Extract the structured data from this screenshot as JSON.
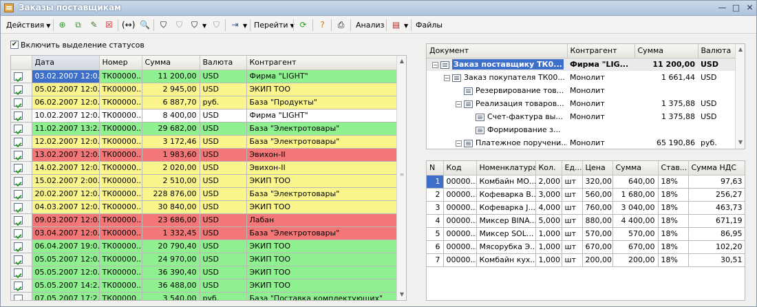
{
  "window": {
    "title": "Заказы поставщикам",
    "min": "—",
    "max": "□",
    "close": "✕"
  },
  "toolbar": {
    "actions": "Действия",
    "goto": "Перейти",
    "analysis": "Анализ",
    "files": "Файлы"
  },
  "status_checkbox": {
    "label": "Включить выделение статусов",
    "checked": "✔"
  },
  "orders": {
    "columns": [
      "",
      "Дата",
      "Номер",
      "Сумма",
      "Валюта",
      "Контрагент"
    ],
    "rows": [
      {
        "date": "03.02.2007 12:0...",
        "num": "ТК00000...",
        "sum": "11 200,00",
        "cur": "USD",
        "party": "Фирма \"LIGHT\"",
        "c": "g"
      },
      {
        "date": "05.02.2007 12:0...",
        "num": "ТК00000...",
        "sum": "2 945,00",
        "cur": "USD",
        "party": "ЭКИП ТОО",
        "c": "y"
      },
      {
        "date": "06.02.2007 12:0...",
        "num": "ТК00000...",
        "sum": "6 887,70",
        "cur": "руб.",
        "party": "База \"Продукты\"",
        "c": "y"
      },
      {
        "date": "10.02.2007 12:0...",
        "num": "ТК00000...",
        "sum": "8 400,00",
        "cur": "USD",
        "party": "Фирма \"LIGHT\"",
        "c": "w"
      },
      {
        "date": "11.02.2007 13:2...",
        "num": "ТК00000...",
        "sum": "29 682,00",
        "cur": "USD",
        "party": "База \"Электротовары\"",
        "c": "g"
      },
      {
        "date": "12.02.2007 12:0...",
        "num": "ТК00000...",
        "sum": "3 172,46",
        "cur": "USD",
        "party": "База \"Электротовары\"",
        "c": "y"
      },
      {
        "date": "13.02.2007 12:0...",
        "num": "ТК00000...",
        "sum": "1 983,60",
        "cur": "USD",
        "party": "Эвихон-II",
        "c": "r"
      },
      {
        "date": "14.02.2007 12:0...",
        "num": "ТК00000...",
        "sum": "2 020,00",
        "cur": "USD",
        "party": "Эвихон-II",
        "c": "y"
      },
      {
        "date": "15.02.2007 2:00...",
        "num": "ТК00000...",
        "sum": "2 510,00",
        "cur": "USD",
        "party": "ЭКИП ТОО",
        "c": "y"
      },
      {
        "date": "20.02.2007 12:0...",
        "num": "ТК00000...",
        "sum": "228 876,00",
        "cur": "USD",
        "party": "База \"Электротовары\"",
        "c": "y"
      },
      {
        "date": "04.03.2007 12:0...",
        "num": "ТК00000...",
        "sum": "30 840,00",
        "cur": "USD",
        "party": "ЭКИП ТОО",
        "c": "y"
      },
      {
        "date": "09.03.2007 12:0...",
        "num": "ТК00000...",
        "sum": "23 686,00",
        "cur": "USD",
        "party": "Лабан",
        "c": "r"
      },
      {
        "date": "03.04.2007 12:0...",
        "num": "ТК00000...",
        "sum": "1 332,45",
        "cur": "USD",
        "party": "База \"Электротовары\"",
        "c": "r"
      },
      {
        "date": "06.04.2007 19:0...",
        "num": "ТК00000...",
        "sum": "20 790,40",
        "cur": "USD",
        "party": "ЭКИП ТОО",
        "c": "g"
      },
      {
        "date": "05.05.2007 12:0...",
        "num": "ТК00000...",
        "sum": "24 970,00",
        "cur": "USD",
        "party": "ЭКИП ТОО",
        "c": "g"
      },
      {
        "date": "05.05.2007 12:0...",
        "num": "ТК00000...",
        "sum": "36 390,40",
        "cur": "USD",
        "party": "ЭКИП ТОО",
        "c": "g"
      },
      {
        "date": "05.05.2007 14:2...",
        "num": "ТК00000...",
        "sum": "36 488,00",
        "cur": "USD",
        "party": "ЭКИП ТОО",
        "c": "g"
      },
      {
        "date": "07.05.2007 17:2...",
        "num": "ТК00000...",
        "sum": "3 540,00",
        "cur": "руб.",
        "party": "База \"Поставка комплектующих\"",
        "c": "g"
      }
    ]
  },
  "tree": {
    "columns": [
      "Документ",
      "Контрагент",
      "Сумма",
      "Валюта"
    ],
    "rows": [
      {
        "indent": 0,
        "exp": "−",
        "doc": "Заказ поставщику ТК0...",
        "party": "Фирма \"LIG...",
        "sum": "11 200,00",
        "cur": "USD",
        "sel": true
      },
      {
        "indent": 1,
        "exp": "−",
        "doc": "Заказ покупателя ТК00...",
        "party": "Монолит",
        "sum": "1 661,44",
        "cur": "USD"
      },
      {
        "indent": 2,
        "exp": "",
        "doc": "Резервирование тов...",
        "party": "Монолит",
        "sum": "",
        "cur": ""
      },
      {
        "indent": 2,
        "exp": "−",
        "doc": "Реализация товаров...",
        "party": "Монолит",
        "sum": "1 375,88",
        "cur": "USD"
      },
      {
        "indent": 3,
        "exp": "",
        "doc": "Счет-фактура вы...",
        "party": "Монолит",
        "sum": "1 375,88",
        "cur": "USD"
      },
      {
        "indent": 3,
        "exp": "",
        "doc": "Формирование з...",
        "party": "",
        "sum": "",
        "cur": ""
      },
      {
        "indent": 2,
        "exp": "−",
        "doc": "Платежное поручени...",
        "party": "Монолит",
        "sum": "65 190,86",
        "cur": "руб."
      }
    ]
  },
  "items": {
    "columns": [
      "N",
      "Код",
      "Номенклатура",
      "Кол.",
      "Ед...",
      "Цена",
      "Сумма",
      "Став...",
      "Сумма НДС"
    ],
    "rows": [
      {
        "n": "1",
        "code": "00000...",
        "name": "Комбайн МО...",
        "qty": "2,000",
        "unit": "шт",
        "price": "320,00",
        "sum": "640,00",
        "rate": "18%",
        "vat": "97,63"
      },
      {
        "n": "2",
        "code": "00000...",
        "name": "Кофеварка В...",
        "qty": "3,000",
        "unit": "шт",
        "price": "560,00",
        "sum": "1 680,00",
        "rate": "18%",
        "vat": "256,27"
      },
      {
        "n": "3",
        "code": "00000...",
        "name": "Кофеварка J...",
        "qty": "4,000",
        "unit": "шт",
        "price": "760,00",
        "sum": "3 040,00",
        "rate": "18%",
        "vat": "463,73"
      },
      {
        "n": "4",
        "code": "00000...",
        "name": "Миксер BINA...",
        "qty": "5,000",
        "unit": "шт",
        "price": "880,00",
        "sum": "4 400,00",
        "rate": "18%",
        "vat": "671,19"
      },
      {
        "n": "5",
        "code": "00000...",
        "name": "Миксер SOL...",
        "qty": "1,000",
        "unit": "шт",
        "price": "570,00",
        "sum": "570,00",
        "rate": "18%",
        "vat": "86,95"
      },
      {
        "n": "6",
        "code": "00000...",
        "name": "Мясорубка Э...",
        "qty": "1,000",
        "unit": "шт",
        "price": "670,00",
        "sum": "670,00",
        "rate": "18%",
        "vat": "102,20"
      },
      {
        "n": "7",
        "code": "00000...",
        "name": "Комбайн кух...",
        "qty": "1,000",
        "unit": "шт",
        "price": "200,00",
        "sum": "200,00",
        "rate": "18%",
        "vat": "30,51"
      }
    ]
  }
}
